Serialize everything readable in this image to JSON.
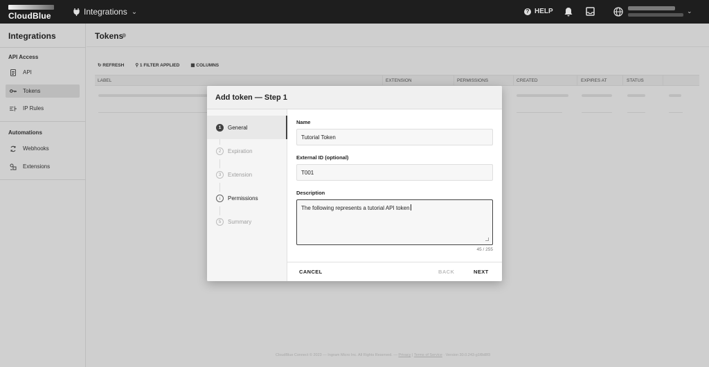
{
  "topbar": {
    "logo_text": "CloudBlue",
    "module_label": "Integrations",
    "help_label": "HELP"
  },
  "sidebar": {
    "title": "Integrations",
    "sections": [
      {
        "label": "API Access",
        "items": [
          {
            "label": "API",
            "icon": "document-icon"
          },
          {
            "label": "Tokens",
            "icon": "key-icon"
          },
          {
            "label": "IP Rules",
            "icon": "ip-rules-icon"
          }
        ]
      },
      {
        "label": "Automations",
        "items": [
          {
            "label": "Webhooks",
            "icon": "webhook-icon"
          },
          {
            "label": "Extensions",
            "icon": "extension-icon"
          }
        ]
      }
    ],
    "active_item": "Tokens"
  },
  "page": {
    "title": "Tokens",
    "toolbar": {
      "refresh_label": "REFRESH",
      "filter_label": "1 FILTER APPLIED",
      "columns_label": "COLUMNS"
    },
    "table_headers": [
      "LABEL",
      "EXTENSION",
      "PERMISSIONS",
      "CREATED",
      "EXPIRES AT",
      "STATUS"
    ]
  },
  "dialog": {
    "title": "Add token — Step 1",
    "steps": [
      {
        "num": "1",
        "label": "General"
      },
      {
        "num": "2",
        "label": "Expiration"
      },
      {
        "num": "3",
        "label": "Extension"
      },
      {
        "num": "↓",
        "label": "Permissions"
      },
      {
        "num": "5",
        "label": "Summary"
      }
    ],
    "active_step": "General",
    "form": {
      "name_label": "Name",
      "name_value": "Tutorial Token",
      "external_id_label": "External ID (optional)",
      "external_id_value": "T001",
      "description_label": "Description",
      "description_value": "The following represents a tutorial API token",
      "description_counter": "45 / 255"
    },
    "actions": {
      "cancel_label": "CANCEL",
      "back_label": "BACK",
      "next_label": "NEXT"
    }
  },
  "footer": {
    "text_before": "CloudBlue Connect © 2023 — Ingram Micro Inc. All Rights Reserved. — ",
    "privacy_label": "Privacy",
    "separator": " | ",
    "terms_label": "Terms of Service",
    "version_text": " · Version 30.0.243-g1f8d8f3"
  },
  "colors": {
    "topbar": "#1e1e1e",
    "overlay_bg": "#cfcfcf",
    "dialog_bg": "#ffffff",
    "accent": "#424242"
  }
}
